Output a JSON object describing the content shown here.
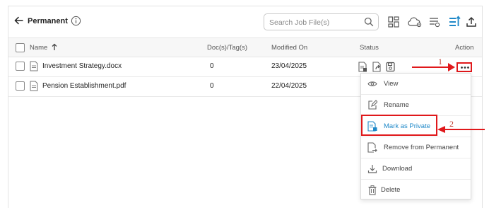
{
  "header": {
    "title": "Permanent",
    "search_placeholder": "Search Job File(s)"
  },
  "table": {
    "columns": {
      "name": "Name",
      "docs_tags": "Doc(s)/Tag(s)",
      "modified": "Modified On",
      "status": "Status",
      "action": "Action"
    },
    "rows": [
      {
        "name": "Investment Strategy.docx",
        "docs": "0",
        "modified": "23/04/2025"
      },
      {
        "name": "Pension Establishment.pdf",
        "docs": "0",
        "modified": "22/04/2025"
      }
    ]
  },
  "menu": {
    "items": [
      {
        "label": "View",
        "icon": "eye-icon"
      },
      {
        "label": "Rename",
        "icon": "edit-icon"
      },
      {
        "label": "Mark as Private",
        "icon": "private-document-icon"
      },
      {
        "label": "Remove from Permanent",
        "icon": "remove-document-icon"
      },
      {
        "label": "Download",
        "icon": "download-icon"
      },
      {
        "label": "Delete",
        "icon": "trash-icon"
      }
    ]
  },
  "annotations": {
    "step1": "1",
    "step2": "2"
  },
  "colors": {
    "accent": "#1e88c8",
    "annotation": "#e0181b",
    "header_bg": "#f7f7f7"
  }
}
